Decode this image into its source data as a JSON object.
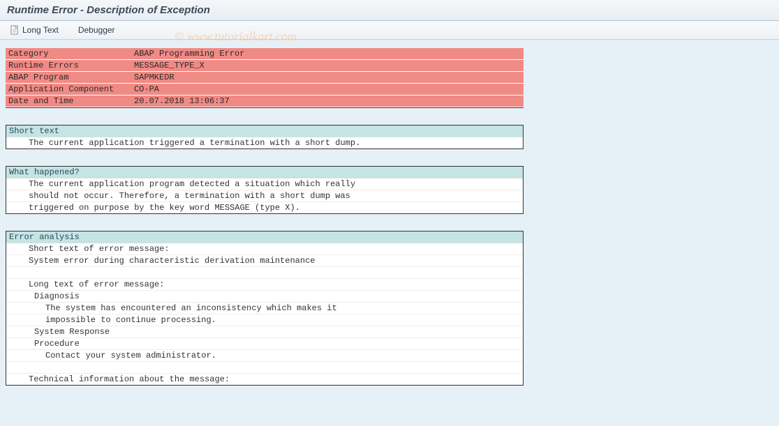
{
  "title": "Runtime Error - Description of Exception",
  "toolbar": {
    "long_text": "Long Text",
    "debugger": "Debugger"
  },
  "watermark": "© www.tutorialkart.com",
  "header": {
    "rows": [
      {
        "label": "Category",
        "value": "ABAP Programming Error"
      },
      {
        "label": "Runtime Errors",
        "value": "MESSAGE_TYPE_X"
      },
      {
        "label": "ABAP Program",
        "value": "SAPMKEDR"
      },
      {
        "label": "Application Component",
        "value": "CO-PA"
      },
      {
        "label": "Date and Time",
        "value": "20.07.2018 13:06:37"
      }
    ]
  },
  "sections": {
    "short_text": {
      "title": "Short text",
      "lines": [
        {
          "text": "The current application triggered a termination with a short dump.",
          "indent": 1
        }
      ]
    },
    "what_happened": {
      "title": "What happened?",
      "lines": [
        {
          "text": "The current application program detected a situation which really",
          "indent": 1
        },
        {
          "text": "should not occur. Therefore, a termination with a short dump was",
          "indent": 1
        },
        {
          "text": "triggered on purpose by the key word MESSAGE (type X).",
          "indent": 1
        }
      ]
    },
    "error_analysis": {
      "title": "Error analysis",
      "lines": [
        {
          "text": "Short text of error message:",
          "indent": 1
        },
        {
          "text": "System error during characteristic derivation maintenance",
          "indent": 1
        },
        {
          "text": "",
          "indent": 1
        },
        {
          "text": "Long text of error message:",
          "indent": 1
        },
        {
          "text": "Diagnosis",
          "indent": 2
        },
        {
          "text": "The system has encountered an inconsistency which makes it",
          "indent": 3
        },
        {
          "text": "impossible to continue processing.",
          "indent": 3
        },
        {
          "text": "System Response",
          "indent": 2
        },
        {
          "text": "Procedure",
          "indent": 2
        },
        {
          "text": "Contact your system administrator.",
          "indent": 3
        },
        {
          "text": "",
          "indent": 1
        },
        {
          "text": "Technical information about the message:",
          "indent": 1
        }
      ]
    }
  }
}
